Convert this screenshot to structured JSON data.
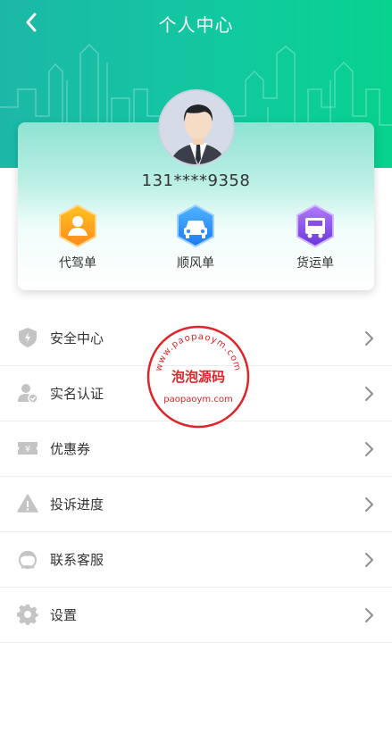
{
  "header": {
    "title": "个人中心",
    "back_icon": "chevron-left-icon",
    "gradient": [
      "#1cb8a7",
      "#07d28e"
    ]
  },
  "profile": {
    "phone": "131****9358",
    "avatar_icon": "user-avatar-icon"
  },
  "services": [
    {
      "label": "代驾单",
      "icon": "driver-icon",
      "color": "#ff9d1f"
    },
    {
      "label": "顺风单",
      "icon": "car-icon",
      "color": "#2b8cff"
    },
    {
      "label": "货运单",
      "icon": "truck-icon",
      "color": "#8a4de8"
    }
  ],
  "menu": [
    {
      "label": "安全中心",
      "icon": "shield-icon"
    },
    {
      "label": "实名认证",
      "icon": "user-verify-icon"
    },
    {
      "label": "优惠券",
      "icon": "coupon-icon"
    },
    {
      "label": "投诉进度",
      "icon": "warning-icon"
    },
    {
      "label": "联系客服",
      "icon": "customer-service-icon"
    },
    {
      "label": "设置",
      "icon": "gear-icon"
    }
  ],
  "watermark": {
    "top_text": "www.paopaoym.com",
    "middle_text": "泡泡源码",
    "bottom_text": "paopaoym.com",
    "color": "#e0242a"
  }
}
